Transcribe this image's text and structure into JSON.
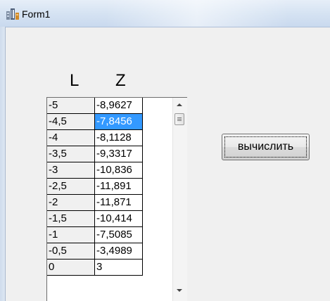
{
  "window": {
    "title": "Form1",
    "icon": "application-icon"
  },
  "grid": {
    "headers": {
      "l": "L",
      "z": "Z"
    },
    "selected_row": 1,
    "rows": [
      {
        "l": "-5",
        "z": "-8,9627"
      },
      {
        "l": "-4,5",
        "z": "-7,8456"
      },
      {
        "l": "-4",
        "z": "-8,1128"
      },
      {
        "l": "-3,5",
        "z": "-9,3317"
      },
      {
        "l": "-3",
        "z": "-10,836"
      },
      {
        "l": "-2,5",
        "z": "-11,891"
      },
      {
        "l": "-2",
        "z": "-11,871"
      },
      {
        "l": "-1,5",
        "z": "-10,414"
      },
      {
        "l": "-1",
        "z": "-7,5085"
      },
      {
        "l": "-0,5",
        "z": "-3,4989"
      },
      {
        "l": "0",
        "z": "3"
      }
    ]
  },
  "buttons": {
    "calculate": "вычислить"
  }
}
